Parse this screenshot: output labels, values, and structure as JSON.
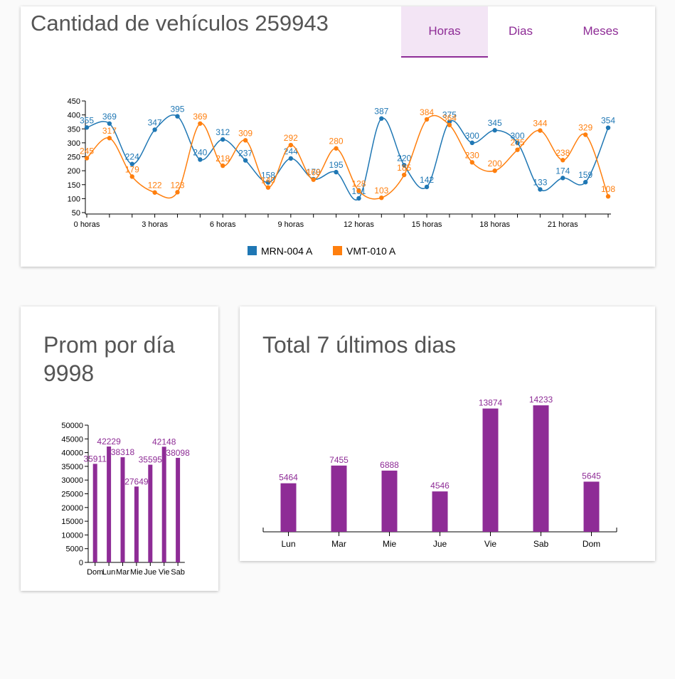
{
  "main_card": {
    "title": "Cantidad de vehículos 259943",
    "tabs": [
      {
        "label": "Horas",
        "active": true
      },
      {
        "label": "Dias",
        "active": false
      },
      {
        "label": "Meses",
        "active": false
      }
    ]
  },
  "avg_card": {
    "title_line1": "Prom por día",
    "title_line2": "9998"
  },
  "total_card": {
    "title": "Total 7 últimos dias"
  },
  "colors": {
    "series_a": "#1f77b4",
    "series_b": "#ff7f0e",
    "bar": "#8e2c96",
    "tab_text": "#8e2c96",
    "tab_active_bg": "#f3e5f5"
  },
  "chart_data": [
    {
      "type": "line",
      "x": [
        0,
        1,
        2,
        3,
        4,
        5,
        6,
        7,
        8,
        9,
        10,
        11,
        12,
        13,
        14,
        15,
        16,
        17,
        18,
        19,
        20,
        21,
        22,
        23
      ],
      "x_tick_labels": [
        {
          "x": 0,
          "label": "0 horas"
        },
        {
          "x": 3,
          "label": "3 horas"
        },
        {
          "x": 6,
          "label": "6 horas"
        },
        {
          "x": 9,
          "label": "9 horas"
        },
        {
          "x": 12,
          "label": "12 horas"
        },
        {
          "x": 15,
          "label": "15 horas"
        },
        {
          "x": 18,
          "label": "18 horas"
        },
        {
          "x": 21,
          "label": "21 horas"
        }
      ],
      "series": [
        {
          "name": "MRN-004 A",
          "values": [
            355,
            369,
            224,
            347,
            395,
            240,
            312,
            237,
            158,
            244,
            170,
            195,
            101,
            387,
            220,
            142,
            375,
            300,
            345,
            300,
            133,
            174,
            159,
            354
          ]
        },
        {
          "name": "VMT-010 A",
          "values": [
            245,
            317,
            179,
            122,
            123,
            369,
            218,
            309,
            140,
            292,
            168,
            280,
            128,
            103,
            185,
            384,
            364,
            230,
            200,
            275,
            344,
            238,
            329,
            108
          ]
        }
      ],
      "yticks": [
        50,
        100,
        150,
        200,
        250,
        300,
        350,
        400,
        450
      ],
      "ylim": [
        50,
        450
      ],
      "legend": "bottom"
    },
    {
      "type": "bar",
      "categories": [
        "Dom",
        "Lun",
        "Mar",
        "Mie",
        "Jue",
        "Vie",
        "Sab"
      ],
      "values": [
        35911,
        42229,
        38318,
        27649,
        35595,
        42148,
        38098
      ],
      "value_labels": [
        "35911",
        "42229",
        "38318",
        "27649",
        "35595",
        "42148",
        "38098"
      ],
      "yticks": [
        0,
        5000,
        10000,
        15000,
        20000,
        25000,
        30000,
        35000,
        40000,
        45000,
        50000
      ],
      "ylim": [
        0,
        50000
      ]
    },
    {
      "type": "bar",
      "categories": [
        "Lun",
        "Mar",
        "Mie",
        "Jue",
        "Vie",
        "Sab",
        "Dom"
      ],
      "values": [
        5464,
        7455,
        6888,
        4546,
        13874,
        14233,
        5645
      ],
      "ylim": [
        0,
        16000
      ]
    }
  ]
}
